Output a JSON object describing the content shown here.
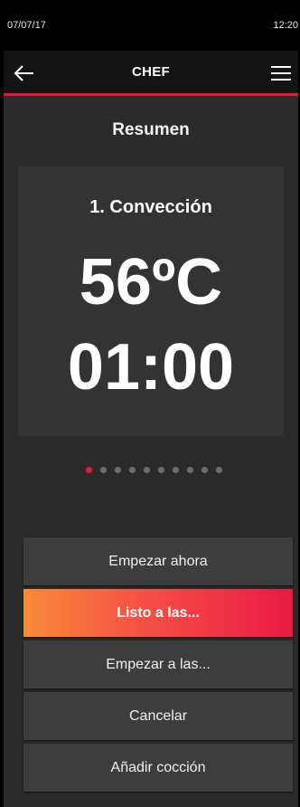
{
  "status_bar": {
    "date": "07/07/17",
    "time": "12:20"
  },
  "app_bar": {
    "title": "CHEF",
    "back_icon": "arrow-left-icon",
    "menu_icon": "hamburger-menu-icon",
    "accent_color": "#e8173d"
  },
  "summary": {
    "title": "Resumen",
    "step_name": "1. Convección",
    "temperature": "56ºC",
    "duration": "01:00"
  },
  "pager": {
    "total": 10,
    "active_index": 0
  },
  "actions": [
    {
      "label": "Empezar ahora",
      "primary": false
    },
    {
      "label": "Listo a las...",
      "primary": true
    },
    {
      "label": "Empezar a las...",
      "primary": false
    },
    {
      "label": "Cancelar",
      "primary": false
    },
    {
      "label": "Añadir cocción",
      "primary": false
    }
  ]
}
